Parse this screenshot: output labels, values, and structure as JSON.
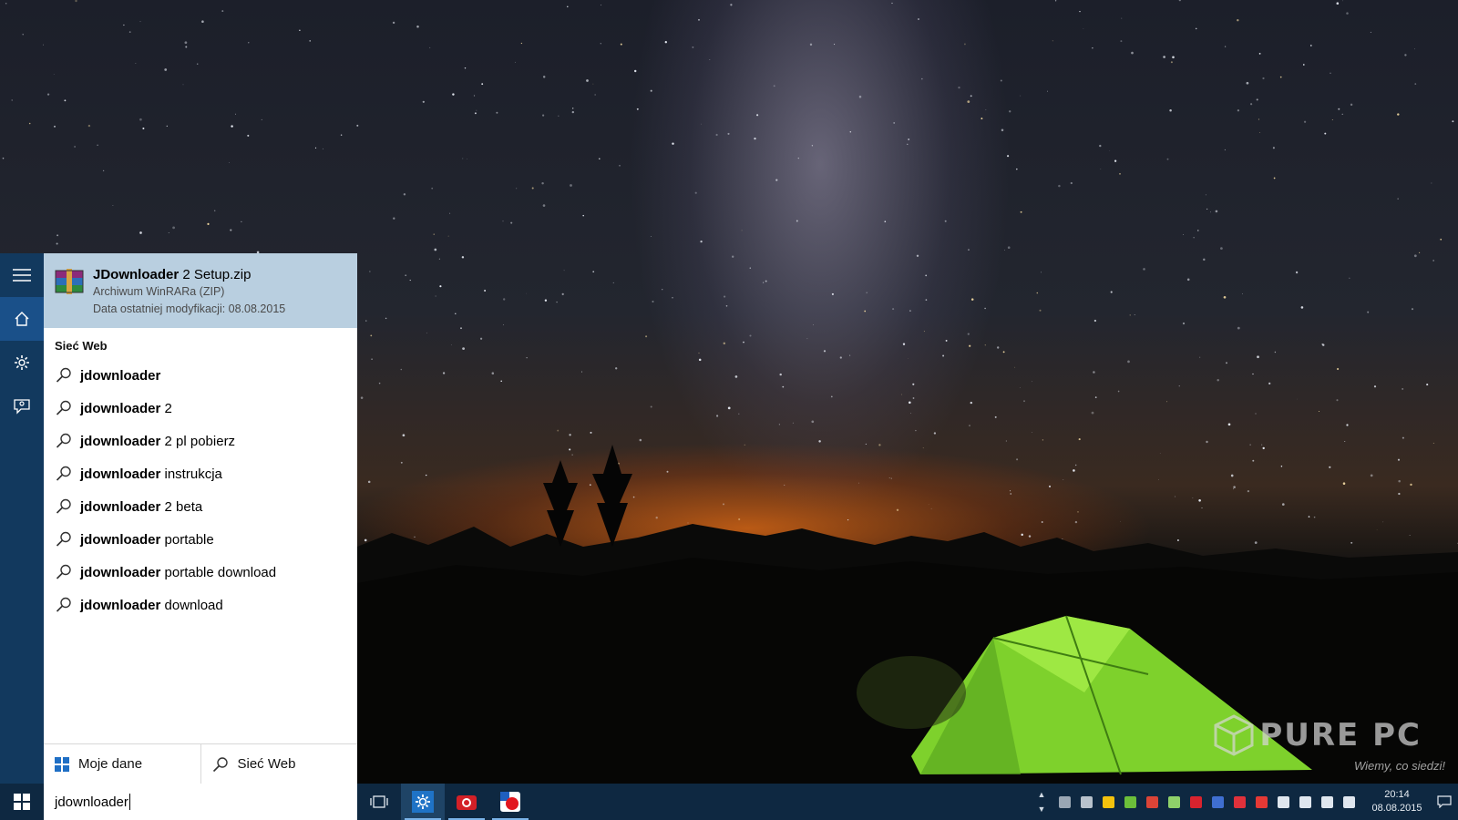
{
  "desktop": {
    "watermark": {
      "brand": "PURE PC",
      "tagline": "Wiemy, co siedzi!"
    }
  },
  "start_menu": {
    "rail": [
      {
        "name": "hamburger-menu-icon"
      },
      {
        "name": "home-icon",
        "active": true
      },
      {
        "name": "gear-icon"
      },
      {
        "name": "feedback-icon"
      }
    ],
    "best_match": {
      "title_bold": "JDownloader",
      "title_rest": " 2 Setup.zip",
      "type": "Archiwum WinRARa (ZIP)",
      "modified": "Data ostatniej modyfikacji: 08.08.2015",
      "icon": "winrar-archive-icon"
    },
    "web_header": "Sieć Web",
    "suggestions": [
      {
        "bold": "jdownloader",
        "rest": ""
      },
      {
        "bold": "jdownloader",
        "rest": " 2"
      },
      {
        "bold": "jdownloader",
        "rest": " 2 pl pobierz"
      },
      {
        "bold": "jdownloader",
        "rest": " instrukcja"
      },
      {
        "bold": "jdownloader",
        "rest": " 2 beta"
      },
      {
        "bold": "jdownloader",
        "rest": " portable"
      },
      {
        "bold": "jdownloader",
        "rest": " portable download"
      },
      {
        "bold": "jdownloader",
        "rest": " download"
      }
    ],
    "scope": {
      "my_stuff": "Moje dane",
      "web": "Sieć Web"
    }
  },
  "taskbar": {
    "search_value": "jdownloader",
    "apps": [
      {
        "name": "task-view-icon",
        "running": false
      },
      {
        "name": "settings-app-icon",
        "running": true,
        "active": true
      },
      {
        "name": "red-camera-app-icon",
        "running": true
      },
      {
        "name": "red-blue-app-icon",
        "running": true
      }
    ],
    "tray_icons": [
      {
        "name": "onedrive-icon",
        "color": "#9aa7b4"
      },
      {
        "name": "monitor-icon",
        "color": "#b8c2cc"
      },
      {
        "name": "google-drive-icon",
        "color": "#f4c20d"
      },
      {
        "name": "utorrent-icon",
        "color": "#6cbf3a"
      },
      {
        "name": "chrome-icon",
        "color": "#db4437"
      },
      {
        "name": "usb-icon",
        "color": "#8fd16a"
      },
      {
        "name": "red-app-icon",
        "color": "#d9232e"
      },
      {
        "name": "keepass-icon",
        "color": "#3f6fd1"
      },
      {
        "name": "pdf-icon",
        "color": "#e0313b"
      },
      {
        "name": "record-icon",
        "color": "#e53935"
      },
      {
        "name": "battery-icon",
        "color": "#dfe6ee"
      },
      {
        "name": "wifi-icon",
        "color": "#dfe6ee"
      },
      {
        "name": "volume-icon",
        "color": "#dfe6ee"
      },
      {
        "name": "keyboard-icon",
        "color": "#dfe6ee"
      }
    ],
    "clock_time": "20:14",
    "clock_date": "08.08.2015"
  },
  "colors": {
    "accent": "#12395e",
    "selection": "#b9cfe0",
    "taskbar": "#0e2841"
  }
}
